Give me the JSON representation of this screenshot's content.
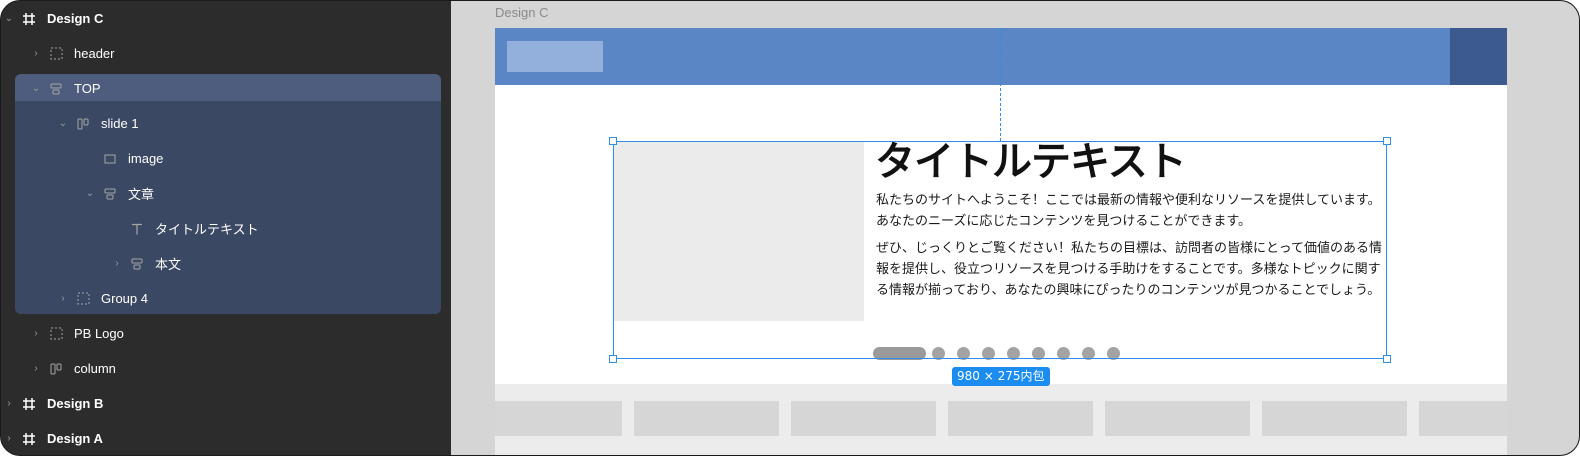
{
  "layers": [
    {
      "label": "Design C",
      "icon": "frame-icon",
      "chevron": "⌄",
      "indent": 0,
      "kind": "frame"
    },
    {
      "label": "header",
      "icon": "dashed-group-icon",
      "chevron": "›",
      "indent": 1,
      "kind": "group"
    },
    {
      "label": "TOP",
      "icon": "autolayout-vertical-icon",
      "chevron": "⌄",
      "indent": 1,
      "kind": "group",
      "selected": true
    },
    {
      "label": "slide 1",
      "icon": "autolayout-horizontal-icon",
      "chevron": "⌄",
      "indent": 2,
      "kind": "group"
    },
    {
      "label": "image",
      "icon": "rectangle-icon",
      "chevron": "",
      "indent": 3,
      "kind": "leaf"
    },
    {
      "label": "文章",
      "icon": "autolayout-vertical-icon",
      "chevron": "⌄",
      "indent": 3,
      "kind": "group"
    },
    {
      "label": "タイトルテキスト",
      "icon": "text-icon",
      "chevron": "",
      "indent": 4,
      "kind": "leaf"
    },
    {
      "label": "本文",
      "icon": "autolayout-vertical-icon",
      "chevron": "›",
      "indent": 4,
      "kind": "group"
    },
    {
      "label": "Group 4",
      "icon": "dashed-group-icon",
      "chevron": "›",
      "indent": 2,
      "kind": "group"
    },
    {
      "label": "PB Logo",
      "icon": "dashed-group-icon",
      "chevron": "›",
      "indent": 1,
      "kind": "group"
    },
    {
      "label": "column",
      "icon": "autolayout-horizontal-icon",
      "chevron": "›",
      "indent": 1,
      "kind": "group"
    },
    {
      "label": "Design B",
      "icon": "frame-icon",
      "chevron": "›",
      "indent": 0,
      "kind": "frame"
    },
    {
      "label": "Design A",
      "icon": "frame-icon",
      "chevron": "›",
      "indent": 0,
      "kind": "frame"
    }
  ],
  "canvas": {
    "frame_label": "Design C",
    "title": "タイトルテキスト",
    "paragraph1": "私たちのサイトへようこそ！ここでは最新の情報や便利なリソースを提供しています。あなたのニーズに応じたコンテンツを見つけることができます。",
    "paragraph2": "ぜひ、じっくりとご覧ください！私たちの目標は、訪問者の皆様にとって価値のある情報を提供し、役立つリソースを見つける手助けをすることです。多様なトピックに関する情報が揃っており、あなたの興味にぴったりのコンテンツが見つかることでしょう。",
    "selection_size": "980 × 275内包",
    "slide_count": 9,
    "active_slide": 1,
    "column_card_count": 7
  },
  "colors": {
    "panel_bg": "#2c2c2c",
    "selection_bg": "#3b4863",
    "header_blue": "#5b86c6",
    "selection_blue": "#2f8ee5"
  }
}
